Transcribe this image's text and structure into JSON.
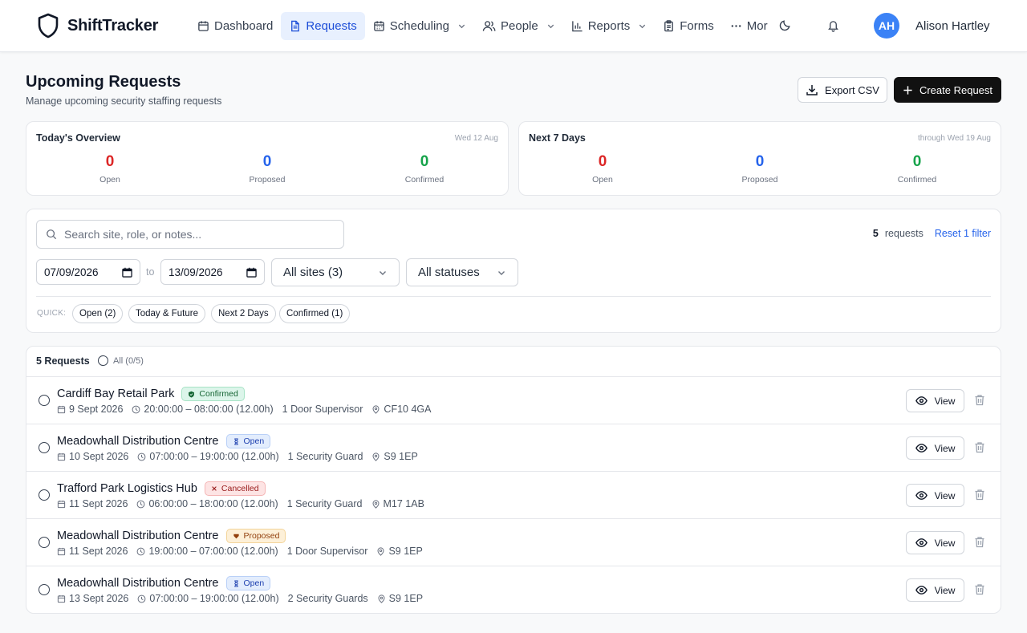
{
  "app": {
    "name": "ShiftTracker"
  },
  "nav": [
    {
      "label": "Dashboard",
      "icon": "calendar-icon",
      "active": false,
      "dropdown": false
    },
    {
      "label": "Requests",
      "icon": "document-icon",
      "active": true,
      "dropdown": false
    },
    {
      "label": "Scheduling",
      "icon": "calendar-icon",
      "active": false,
      "dropdown": true
    },
    {
      "label": "People",
      "icon": "users-icon",
      "active": false,
      "dropdown": true
    },
    {
      "label": "Reports",
      "icon": "bar-chart-icon",
      "active": false,
      "dropdown": true
    },
    {
      "label": "Forms",
      "icon": "clipboard-icon",
      "active": false,
      "dropdown": false
    },
    {
      "label": "Mor",
      "icon": "more-dots-icon",
      "active": false,
      "dropdown": false
    }
  ],
  "user": {
    "initials": "AH",
    "name": "Alison Hartley"
  },
  "page": {
    "title": "Upcoming Requests",
    "subtitle": "Manage upcoming security staffing requests",
    "export_label": "Export CSV",
    "create_label": "Create Request"
  },
  "overview": [
    {
      "title": "Today's Overview",
      "date": "Wed 12 Aug",
      "stats": [
        {
          "value": "0",
          "label": "Open"
        },
        {
          "value": "0",
          "label": "Proposed"
        },
        {
          "value": "0",
          "label": "Confirmed"
        }
      ]
    },
    {
      "title": "Next 7 Days",
      "date": "through Wed 19 Aug",
      "stats": [
        {
          "value": "0",
          "label": "Open"
        },
        {
          "value": "0",
          "label": "Proposed"
        },
        {
          "value": "0",
          "label": "Confirmed"
        }
      ]
    }
  ],
  "filters": {
    "search_placeholder": "Search site, role, or notes...",
    "count": "5",
    "count_label": "requests",
    "reset_label": "Reset 1 filter",
    "date_from": "07/09/2026",
    "to_label": "to",
    "date_to": "13/09/2026",
    "sites_select": "All sites (3)",
    "status_select": "All statuses",
    "quick_label": "QUICK:",
    "quick_chips": [
      "Open (2)",
      "Today & Future",
      "Next 2 Days",
      "Confirmed (1)"
    ]
  },
  "list": {
    "title": "5 Requests",
    "select_all": "All (0/5)",
    "view_label": "View",
    "rows": [
      {
        "site": "Cardiff Bay Retail Park",
        "status": "Confirmed",
        "date": "9 Sept 2026",
        "time": "20:00:00 – 08:00:00 (12.00h)",
        "role": "1 Door Supervisor",
        "postcode": "CF10 4GA"
      },
      {
        "site": "Meadowhall Distribution Centre",
        "status": "Open",
        "date": "10 Sept 2026",
        "time": "07:00:00 – 19:00:00 (12.00h)",
        "role": "1 Security Guard",
        "postcode": "S9 1EP"
      },
      {
        "site": "Trafford Park Logistics Hub",
        "status": "Cancelled",
        "date": "11 Sept 2026",
        "time": "06:00:00 – 18:00:00 (12.00h)",
        "role": "1 Security Guard",
        "postcode": "M17 1AB"
      },
      {
        "site": "Meadowhall Distribution Centre",
        "status": "Proposed",
        "date": "11 Sept 2026",
        "time": "19:00:00 – 07:00:00 (12.00h)",
        "role": "1 Door Supervisor",
        "postcode": "S9 1EP"
      },
      {
        "site": "Meadowhall Distribution Centre",
        "status": "Open",
        "date": "13 Sept 2026",
        "time": "07:00:00 – 19:00:00 (12.00h)",
        "role": "2 Security Guards",
        "postcode": "S9 1EP"
      }
    ]
  },
  "colors": {
    "open": "#dc2626",
    "proposed": "#2563eb",
    "confirmed": "#16a34a",
    "primary_button": "#111111",
    "active_nav": "#1d4ed8",
    "avatar": "#3b82f6"
  }
}
